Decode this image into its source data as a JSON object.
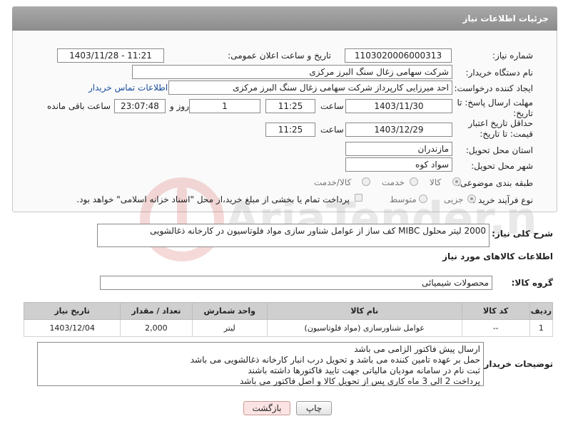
{
  "header": {
    "title": "جزئیات اطلاعات نیاز"
  },
  "form": {
    "need_number_label": "شماره نیاز:",
    "need_number": "1103020006000313",
    "announce_label": "تاریخ و ساعت اعلان عمومی:",
    "announce_value": "1403/11/28 - 11:21",
    "buyer_org_label": "نام دستگاه خریدار:",
    "buyer_org": "شرکت سهامی زغال سنگ البرز مرکزی",
    "creator_label": "ایجاد کننده درخواست:",
    "creator": "احد میرزایی کارپرداز شرکت سهامی زغال سنگ البرز مرکزی",
    "contact_link": "اطلاعات تماس خریدار",
    "reply_deadline_label": "مهلت ارسال پاسخ: تا تاریخ:",
    "reply_date": "1403/11/30",
    "time_label": "ساعت",
    "reply_time": "11:25",
    "days_value": "1",
    "days_label": "روز و",
    "remaining_time": "23:07:48",
    "remaining_label": "ساعت باقی مانده",
    "price_validity_label": "حداقل تاریخ اعتبار قیمت: تا تاریخ:",
    "validity_date": "1403/12/29",
    "validity_time": "11:25",
    "province_label": "استان محل تحویل:",
    "province": "مازندران",
    "city_label": "شهر محل تحویل:",
    "city": "سواد کوه",
    "category_label": "طبقه بندی موضوعی:",
    "category_options": [
      "کالا",
      "خدمت",
      "کالا/خدمت"
    ],
    "purchase_type_label": "نوع فرآیند خرید :",
    "purchase_options": [
      "جزیی",
      "متوسط"
    ],
    "payment_note": "پرداخت تمام یا بخشی از مبلغ خرید،از محل \"اسناد خزانه اسلامی\" خواهد بود."
  },
  "description": {
    "label": "شرح کلی نیاز:",
    "text": "2000 لیتر محلول MIBC کف ساز از عوامل شناور سازی مواد فلوتاسیون در کارخانه ذغالشویی"
  },
  "goods_section": {
    "title": "اطلاعات کالاهای مورد نیاز",
    "group_label": "گروه کالا:",
    "group_value": "محصولات شیمیائی"
  },
  "table": {
    "headers": [
      "ردیف",
      "کد کالا",
      "نام کالا",
      "واحد شمارش",
      "تعداد / مقدار",
      "تاریخ نیاز"
    ],
    "rows": [
      [
        "1",
        "--",
        "عوامل شناورسازی (مواد فلوتاسیون)",
        "لیتر",
        "2,000",
        "1403/12/04"
      ]
    ]
  },
  "buyer_notes": {
    "label": "توضیحات خریدار:",
    "lines": [
      "ارسال پیش فاکتور الزامی می باشد",
      "حمل بر عهده تامین کننده می باشد و تحویل درب انبار کارخانه ذغالشویی می باشد",
      "ثبت نام در سامانه مودیان مالیاتی جهت تایید فاکتورها داشته باشند",
      "پرداخت 2 الی 3 ماه کاری پس از تحویل کالا و اصل فاکتور می باشد"
    ]
  },
  "buttons": {
    "print": "چاپ",
    "back": "بازگشت"
  },
  "watermark": {
    "text": "AriaTender.net"
  }
}
